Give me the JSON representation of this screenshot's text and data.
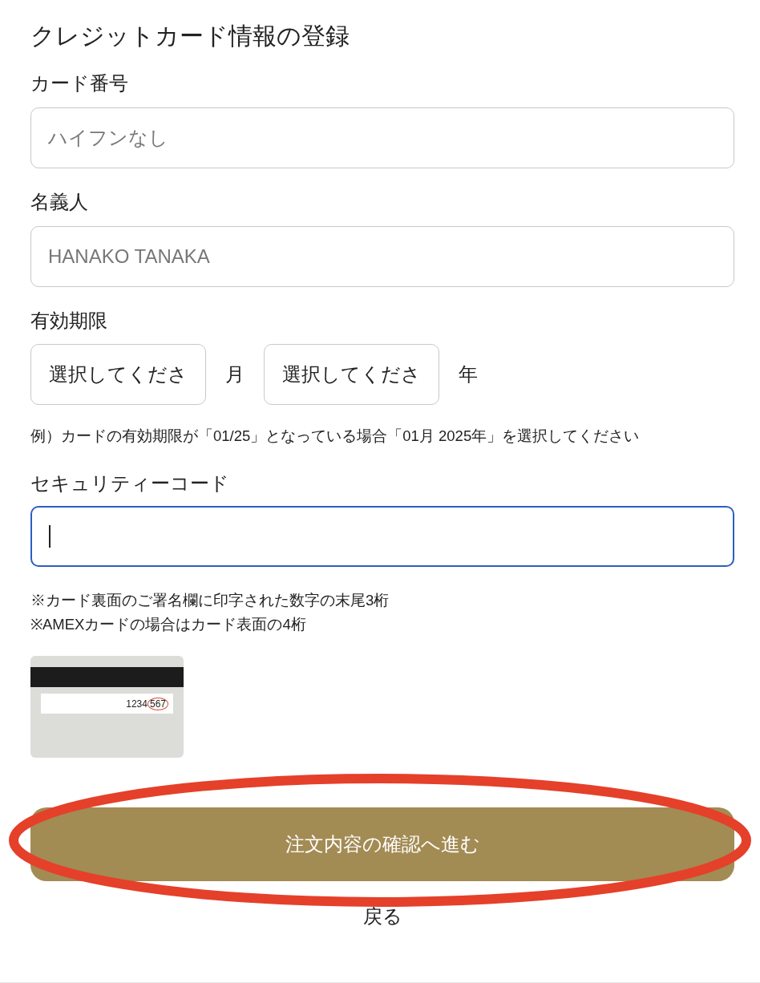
{
  "title": "クレジットカード情報の登録",
  "card_number": {
    "label": "カード番号",
    "placeholder": "ハイフンなし"
  },
  "holder": {
    "label": "名義人",
    "placeholder": "HANAKO TANAKA"
  },
  "expiry": {
    "label": "有効期限",
    "month": {
      "value": "選択してくださ",
      "unit": "月"
    },
    "year": {
      "value": "選択してくださ",
      "unit": "年"
    },
    "note": "例）カードの有効期限が「01/25」となっている場合「01月 2025年」を選択してください"
  },
  "security_code": {
    "label": "セキュリティーコード",
    "focused": true,
    "notes": [
      "※カード裏面のご署名欄に印字された数字の末尾3桁",
      "※AMEXカードの場合はカード表面の4桁"
    ]
  },
  "card_sample": {
    "digits": "1234",
    "code": "567"
  },
  "confirm_button": {
    "label": "注文内容の確認へ進む",
    "highlighted": true
  },
  "back_link": "戻る"
}
